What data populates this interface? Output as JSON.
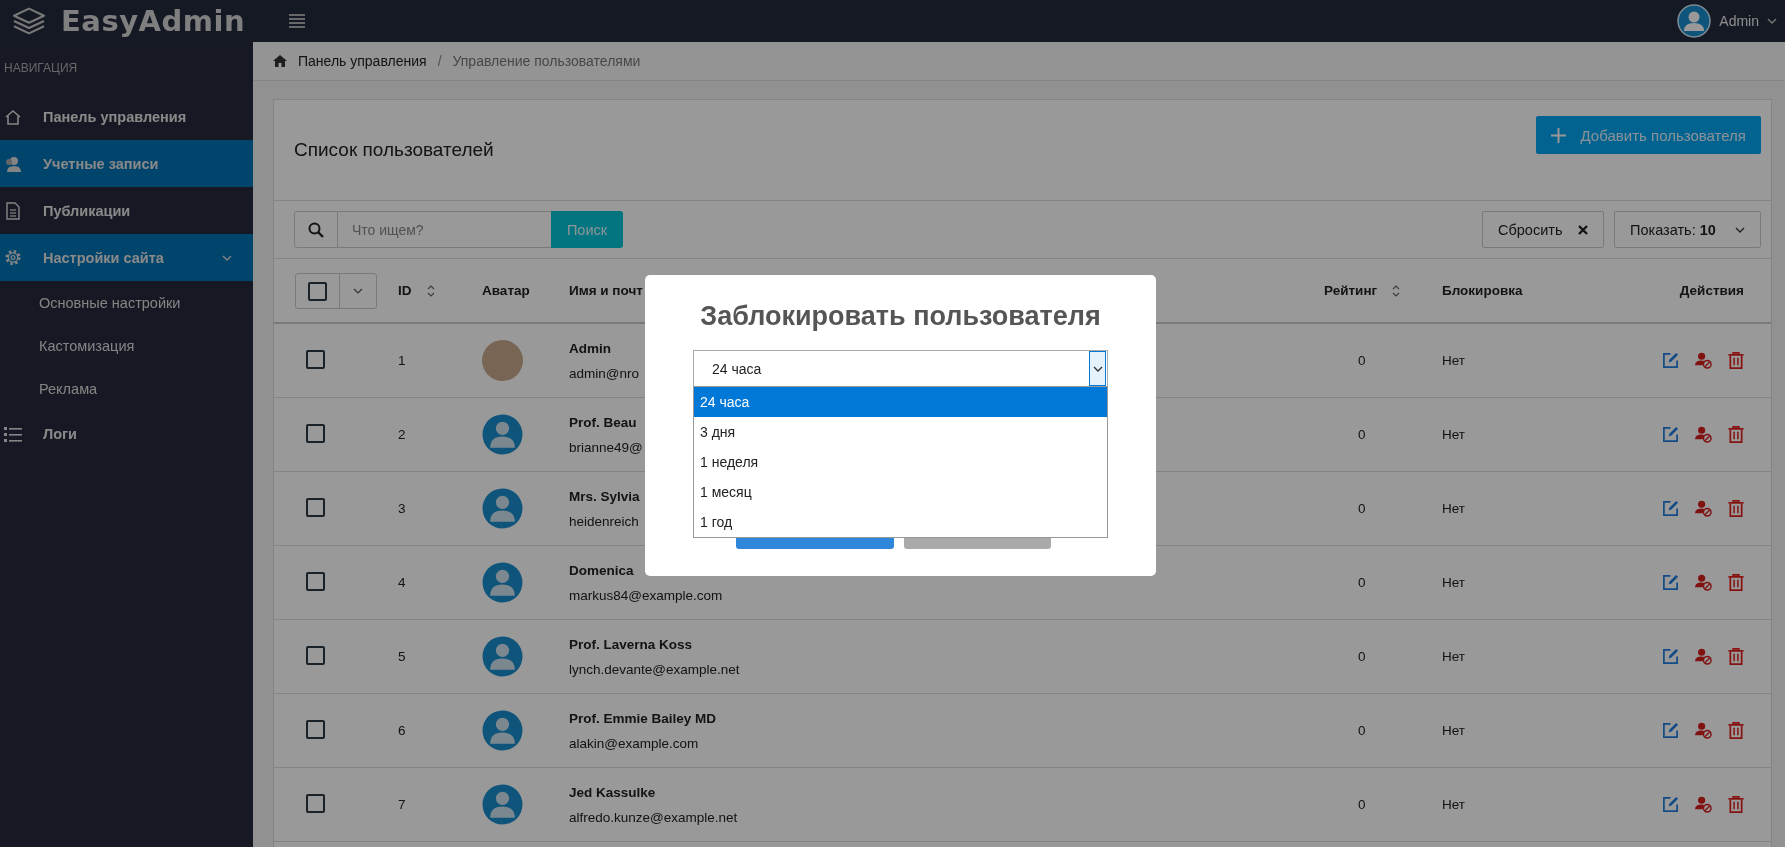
{
  "header": {
    "brand": "EasyAdmin",
    "user": "Admin"
  },
  "sidebar": {
    "heading": "НАВИГАЦИЯ",
    "items": [
      {
        "label": "Панель управления",
        "selected": false
      },
      {
        "label": "Учетные записи",
        "selected": true
      },
      {
        "label": "Публикации",
        "selected": false
      },
      {
        "label": "Настройки сайта",
        "selected": true,
        "expanded": true,
        "children": [
          {
            "label": "Основные настройки"
          },
          {
            "label": "Кастомизация"
          },
          {
            "label": "Реклама"
          }
        ]
      },
      {
        "label": "Логи",
        "selected": false
      }
    ]
  },
  "breadcrumb": [
    "Панель управления",
    "Управление пользователями"
  ],
  "breadcrumb_separator": "/",
  "card": {
    "title": "Список пользователей",
    "add_button": "Добавить пользователя"
  },
  "toolbar": {
    "search_placeholder": "Что ищем?",
    "search_button": "Поиск",
    "reset_button": "Сбросить",
    "show_label": "Показать:",
    "show_value": "10"
  },
  "table": {
    "select_all_checked": false,
    "columns": [
      {
        "label": "ID",
        "sortable": true
      },
      {
        "label": "Аватар",
        "sortable": false
      },
      {
        "label": "Имя и почт",
        "sortable": false
      },
      {
        "label": "Рейтинг",
        "sortable": true
      },
      {
        "label": "Блокировка",
        "sortable": false
      },
      {
        "label": "Действия",
        "sortable": false
      }
    ],
    "rows": [
      {
        "checked": false,
        "id": "1",
        "kind": "photo",
        "name": "Admin",
        "email": "admin@nro",
        "rating": "0",
        "blocked": "Нет"
      },
      {
        "checked": false,
        "id": "2",
        "kind": "default",
        "name": "Prof. Beau",
        "email": "brianne49@",
        "rating": "0",
        "blocked": "Нет"
      },
      {
        "checked": false,
        "id": "3",
        "kind": "default",
        "name": "Mrs. Sylvia",
        "email": "heidenreich",
        "rating": "0",
        "blocked": "Нет"
      },
      {
        "checked": false,
        "id": "4",
        "kind": "default",
        "name": "Domenica",
        "email": "markus84@example.com",
        "rating": "0",
        "blocked": "Нет"
      },
      {
        "checked": false,
        "id": "5",
        "kind": "default",
        "name": "Prof. Laverna Koss",
        "email": "lynch.devante@example.net",
        "rating": "0",
        "blocked": "Нет"
      },
      {
        "checked": false,
        "id": "6",
        "kind": "default",
        "name": "Prof. Emmie Bailey MD",
        "email": "alakin@example.com",
        "rating": "0",
        "blocked": "Нет"
      },
      {
        "checked": false,
        "id": "7",
        "kind": "default",
        "name": "Jed Kassulke",
        "email": "alfredo.kunze@example.net",
        "rating": "0",
        "blocked": "Нет"
      }
    ]
  },
  "modal": {
    "title": "Заблокировать пользователя",
    "value": "24 часа",
    "options": [
      {
        "label": "24 часа",
        "selected": true
      },
      {
        "label": "3 дня",
        "selected": false
      },
      {
        "label": "1 неделя",
        "selected": false
      },
      {
        "label": "1 месяц",
        "selected": false
      },
      {
        "label": "1 год",
        "selected": false
      }
    ]
  }
}
